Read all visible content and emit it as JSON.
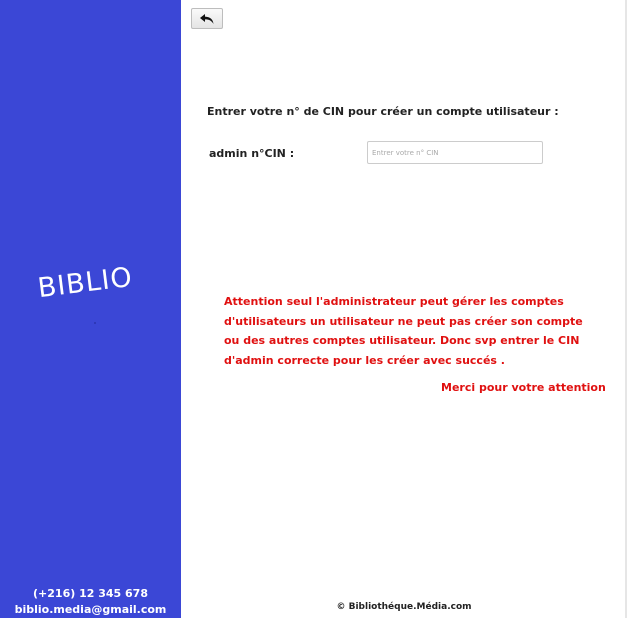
{
  "sidebar": {
    "logo_text": "BIBLIO",
    "phone": "(+216) 12 345 678",
    "email": "biblio.media@gmail.com"
  },
  "toolbar": {
    "back_icon": "back-arrow-icon"
  },
  "form": {
    "instruction": "Entrer votre n° de CIN pour créer un compte utilisateur :",
    "cin_label": "admin n°CIN :",
    "cin_value": "",
    "cin_placeholder": "Entrer votre n° CIN"
  },
  "notice": {
    "warning": "Attention seul l'administrateur peut gérer les comptes d'utilisateurs un utilisateur ne peut pas créer son compte ou des autres comptes utilisateur. Donc svp entrer le CIN d'admin correcte pour les créer avec succés .",
    "thanks": "Merci pour votre attention"
  },
  "footer": {
    "copyright": "© Bibliothéque.Média.com"
  },
  "colors": {
    "sidebar_bg": "#3b47d6",
    "warning": "#e01010"
  }
}
